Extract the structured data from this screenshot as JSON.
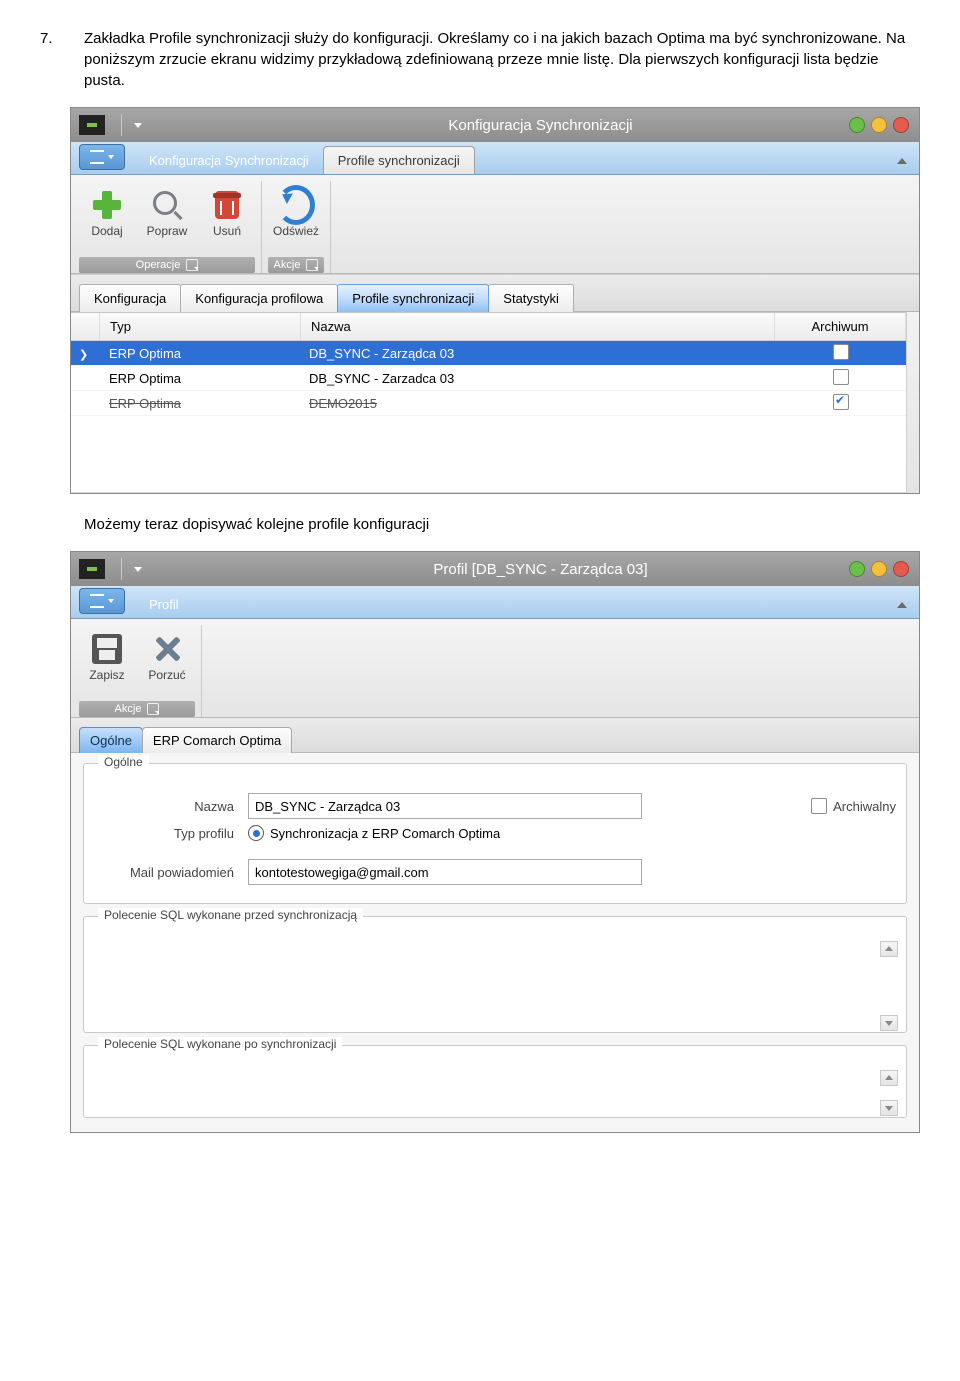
{
  "doc": {
    "num": "7.",
    "para": "Zakładka Profile synchronizacji służy do konfiguracji. Określamy co i na jakich bazach Optima ma być synchronizowane. Na poniższym zrzucie ekranu widzimy przykładową zdefiniowaną przeze mnie listę.  Dla pierwszych konfiguracji lista będzie pusta.",
    "mid": "Możemy teraz dopisywać kolejne profile konfiguracji"
  },
  "win1": {
    "title": "Konfiguracja Synchronizacji",
    "ribbonTabs": [
      "Konfiguracja Synchronizacji",
      "Profile synchronizacji"
    ],
    "ribbonActive": 1,
    "grpOperacje": {
      "caption": "Operacje",
      "btns": {
        "add": "Dodaj",
        "edit": "Popraw",
        "del": "Usuń"
      }
    },
    "grpAkcje": {
      "caption": "Akcje",
      "btns": {
        "refresh": "Odśwież"
      }
    },
    "subtabs": [
      "Konfiguracja",
      "Konfiguracja profilowa",
      "Profile synchronizacji",
      "Statystyki"
    ],
    "subtabActive": 2,
    "grid": {
      "headers": {
        "typ": "Typ",
        "nazwa": "Nazwa",
        "arch": "Archiwum"
      },
      "rows": [
        {
          "typ": "ERP Optima",
          "nazwa": "DB_SYNC - Zarządca 03",
          "arch": false,
          "selected": true,
          "archived": false
        },
        {
          "typ": "ERP Optima",
          "nazwa": "DB_SYNC - Zarzadca 03",
          "arch": false,
          "selected": false,
          "archived": false
        },
        {
          "typ": "ERP Optima",
          "nazwa": "DEMO2015",
          "arch": true,
          "selected": false,
          "archived": true
        }
      ]
    }
  },
  "win2": {
    "title": "Profil [DB_SYNC - Zarządca 03]",
    "ribbonTabs": [
      "Profil"
    ],
    "grpAkcje": {
      "caption": "Akcje",
      "btns": {
        "save": "Zapisz",
        "discard": "Porzuć"
      }
    },
    "ftabs": [
      "Ogólne",
      "ERP Comarch Optima"
    ],
    "ftabActive": 0,
    "form": {
      "general": {
        "legend": "Ogólne",
        "lbl_name": "Nazwa",
        "val_name": "DB_SYNC - Zarządca 03",
        "lbl_arch": "Archiwalny",
        "lbl_type": "Typ profilu",
        "radio": "Synchronizacja z ERP Comarch Optima",
        "lbl_mail": "Mail powiadomień",
        "val_mail": "kontotestowegiga@gmail.com"
      },
      "sqlBefore": "Polecenie SQL wykonane przed synchronizacją",
      "sqlAfter": "Polecenie SQL wykonane po synchronizacji"
    }
  }
}
